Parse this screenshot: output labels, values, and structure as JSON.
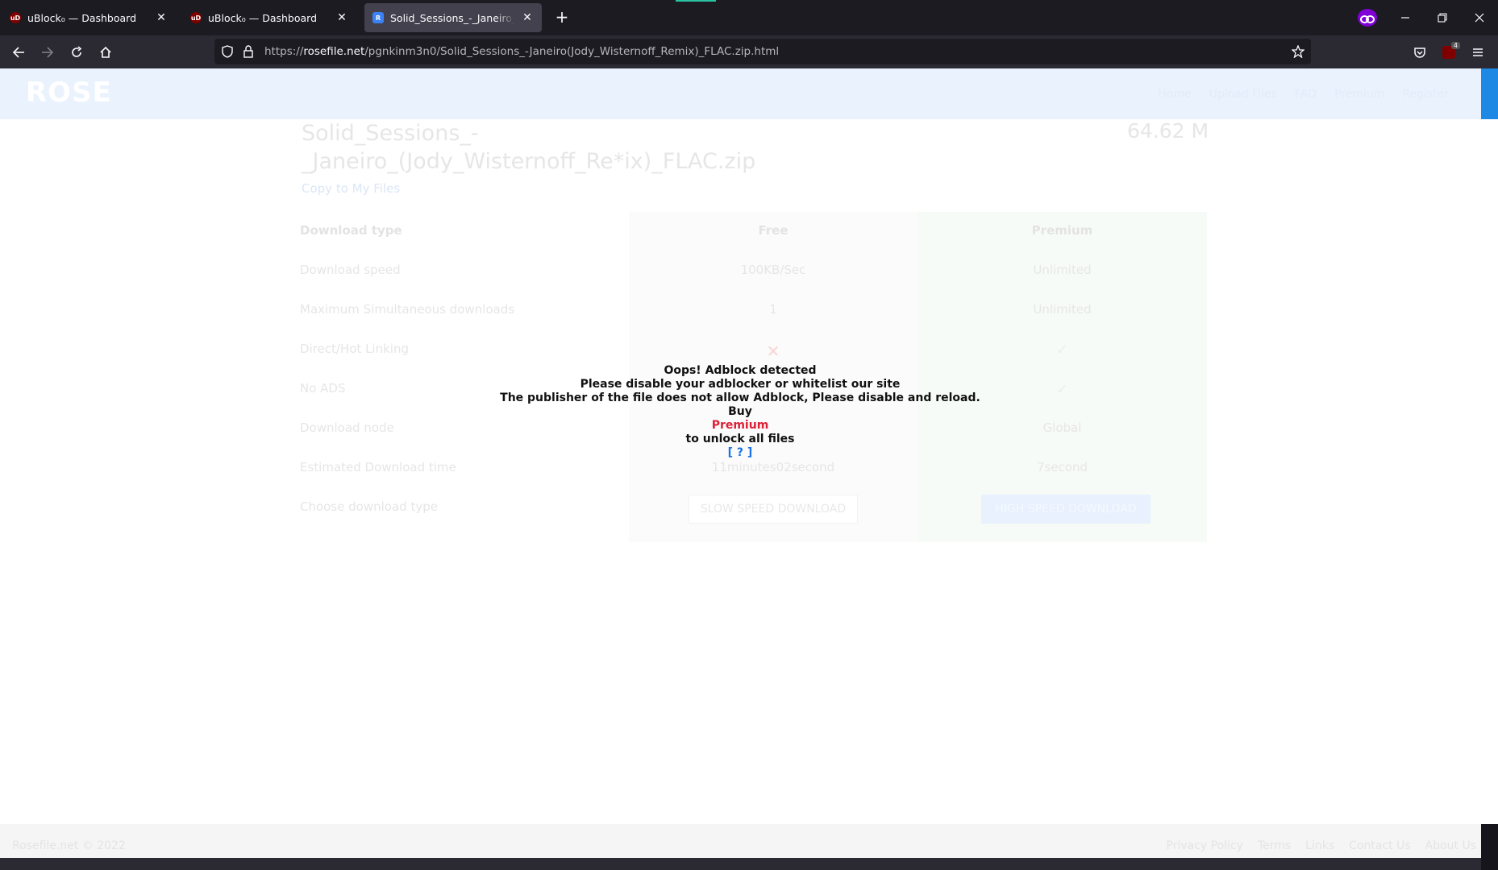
{
  "browser": {
    "tabs": [
      {
        "label": "uBlock₀ — Dashboard",
        "icon": "ublock-icon",
        "active": false
      },
      {
        "label": "uBlock₀ — Dashboard",
        "icon": "ublock-icon",
        "active": false
      },
      {
        "label": "Solid_Sessions_-_Janeiro_(Jody_W",
        "icon": "rosefile-icon",
        "active": true
      }
    ],
    "newtab_label": "+",
    "url": {
      "prefix": "https://",
      "host": "rosefile.net",
      "path": "/pgnkinm3n0/Solid_Sessions_-Janeiro(Jody_Wisternoff_Remix)_FLAC.zip.html"
    },
    "extension_badge": "4"
  },
  "site": {
    "logo": "ROSE",
    "nav_links": [
      "Home",
      "Upload Files",
      "FAQ",
      "Premium",
      "Register"
    ],
    "file_title": "Solid_Sessions_-_Janeiro_(Jody_Wisternoff_Re*ix)_FLAC.zip",
    "file_size": "64.62 M",
    "copy_link": "Copy to My Files",
    "table": {
      "header": {
        "label": "Download type",
        "free": "Free",
        "premium": "Premium"
      },
      "rows": [
        {
          "label": "Download speed",
          "free": "100KB/Sec",
          "premium": "Unlimited"
        },
        {
          "label": "Maximum Simultaneous downloads",
          "free": "1",
          "premium": "Unlimited"
        },
        {
          "label": "Direct/Hot Linking",
          "free": "✕",
          "premium": "✓"
        },
        {
          "label": "No ADS",
          "free": "",
          "premium": "✓"
        },
        {
          "label": "Download node",
          "free": "",
          "premium": "Global"
        },
        {
          "label": "Estimated Download time",
          "free": "11minutes02second",
          "premium": "7second"
        }
      ],
      "choose_label": "Choose download type",
      "slow_button": "SLOW SPEED DOWNLOAD",
      "fast_button": "HIGH SPEED DOWNLOAD"
    },
    "adblock_overlay": {
      "line1": "Oops! Adblock detected",
      "line2": "Please disable your adblocker or whitelist our site",
      "line3": "The publisher of the file does not allow Adblock, Please disable and reload.",
      "line4": "Buy",
      "premium": "Premium",
      "line5": "to unlock all files",
      "help": "[ ? ]"
    },
    "footer": {
      "copyright": "Rosefile.net © 2022",
      "links": [
        "Privacy Policy",
        "Terms",
        "Links",
        "Contact Us",
        "About Us"
      ]
    }
  }
}
